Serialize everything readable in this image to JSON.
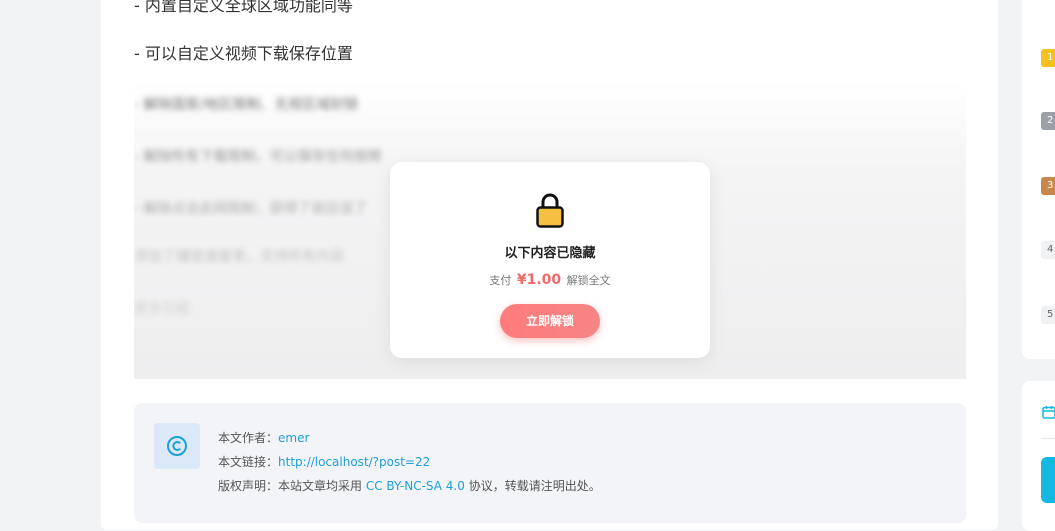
{
  "article": {
    "para_cut": "- 内置自定义全球区域功能同等",
    "para_2": "- 可以自定义视频下载保存位置",
    "blurred_lines": [
      "- 解除国家/地区限制、无视区域封锁",
      "- 解除所有下载限制，可以保存任何视频",
      "- 解除点击此网限制，获得了就应该了",
      "添加了播放速度等，支持所有内容",
      "更多功能"
    ]
  },
  "paywall": {
    "title": "以下内容已隐藏",
    "price_prefix": "支付",
    "price": "¥1.00",
    "price_suffix": "解锁全文",
    "button_label": "立即解锁",
    "icon": "lock-icon",
    "lock_color": "#f5c042",
    "button_color": "#f58585"
  },
  "copyright": {
    "icon": "copyright-icon",
    "author_label": "本文作者：",
    "author": "emer",
    "link_label": "本文链接：",
    "link": "http://localhost/?post=22",
    "license_label": "版权声明：本站文章均采用",
    "license_link": "CC BY-NC-SA 4.0",
    "license_suffix": "协议，转载请注明出处。",
    "link_color": "#1e9fd8"
  },
  "sidebar": {
    "ranks": [
      "1",
      "2",
      "3",
      "4",
      "5"
    ],
    "icon": "calendar-icon",
    "accent": "#14b8e0"
  }
}
